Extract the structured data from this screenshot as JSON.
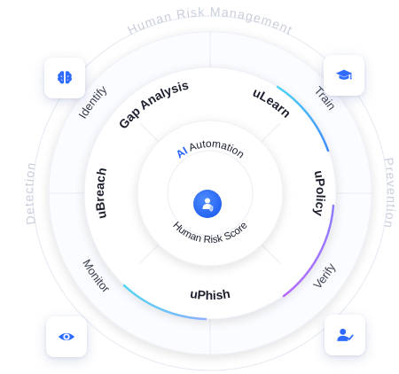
{
  "outer": {
    "top": "Human Risk Management",
    "left": "Detection",
    "right": "Prevention"
  },
  "middle": {
    "identify": "Identify",
    "train": "Train",
    "monitor": "Monitor",
    "verify": "Verify"
  },
  "products": {
    "gap_analysis": "Gap Analysis",
    "ulearn": "uLearn",
    "ubreach": "uBreach",
    "upolicy": "uPolicy",
    "uphish": "uPhish"
  },
  "core": {
    "ai_prefix": "AI",
    "automation": "Automation",
    "score": "Human Risk Score"
  },
  "colors": {
    "accent": "#2f6bff",
    "ai_blue": "#2463ff",
    "text_dark": "#1b1f2e",
    "text_mid": "#3a4050",
    "text_light": "#c9cedb",
    "ring_stroke": "#e6e9f2",
    "gradient_cyan": "#4fd4f2",
    "gradient_purple": "#a766ff"
  },
  "icons": {
    "top_left": "brain-icon",
    "top_right": "graduation-cap-icon",
    "bottom_left": "eye-icon",
    "bottom_right": "user-check-icon",
    "center": "user-shield-icon"
  }
}
